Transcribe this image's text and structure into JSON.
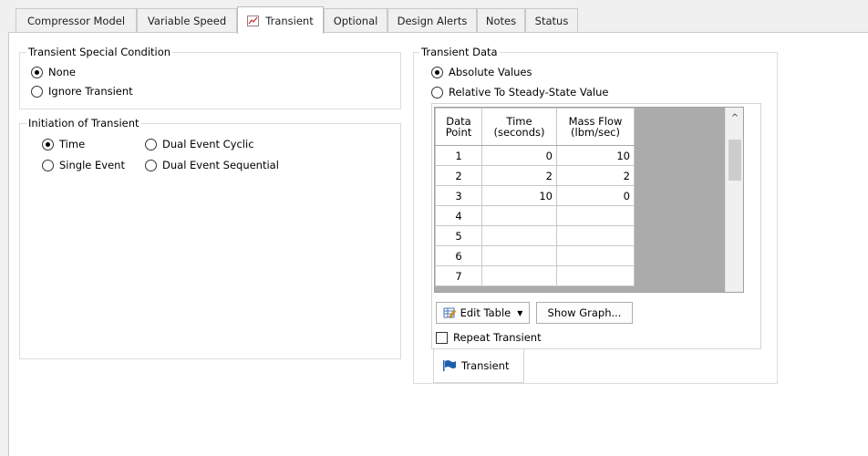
{
  "tabs": [
    {
      "label": "Compressor Model"
    },
    {
      "label": "Variable Speed"
    },
    {
      "label": "Transient"
    },
    {
      "label": "Optional"
    },
    {
      "label": "Design Alerts"
    },
    {
      "label": "Notes"
    },
    {
      "label": "Status"
    }
  ],
  "special_condition": {
    "title": "Transient Special Condition",
    "options": [
      {
        "label": "None",
        "selected": true
      },
      {
        "label": "Ignore Transient",
        "selected": false
      }
    ]
  },
  "initiation": {
    "title": "Initiation of Transient",
    "options": [
      {
        "label": "Time",
        "selected": true
      },
      {
        "label": "Single Event",
        "selected": false
      },
      {
        "label": "Dual Event Cyclic",
        "selected": false
      },
      {
        "label": "Dual Event Sequential",
        "selected": false
      }
    ]
  },
  "transient_data": {
    "title": "Transient Data",
    "options": [
      {
        "label": "Absolute Values",
        "selected": true
      },
      {
        "label": "Relative To Steady-State Value",
        "selected": false
      }
    ],
    "columns": [
      {
        "line1": "Data",
        "line2": "Point"
      },
      {
        "line1": "Time",
        "line2": "(seconds)"
      },
      {
        "line1": "Mass Flow",
        "line2": "(lbm/sec)"
      }
    ],
    "rows": [
      {
        "point": "1",
        "time": "0",
        "flow": "10"
      },
      {
        "point": "2",
        "time": "2",
        "flow": "2"
      },
      {
        "point": "3",
        "time": "10",
        "flow": "0"
      },
      {
        "point": "4",
        "time": "",
        "flow": ""
      },
      {
        "point": "5",
        "time": "",
        "flow": ""
      },
      {
        "point": "6",
        "time": "",
        "flow": ""
      },
      {
        "point": "7",
        "time": "",
        "flow": ""
      }
    ],
    "edit_table_label": "Edit Table",
    "show_graph_label": "Show Graph...",
    "repeat_label": "Repeat Transient",
    "repeat_checked": false,
    "subtab_label": "Transient"
  },
  "colors": {
    "grid_background": "#ababab",
    "flag_icon": "#1f5fb0"
  }
}
